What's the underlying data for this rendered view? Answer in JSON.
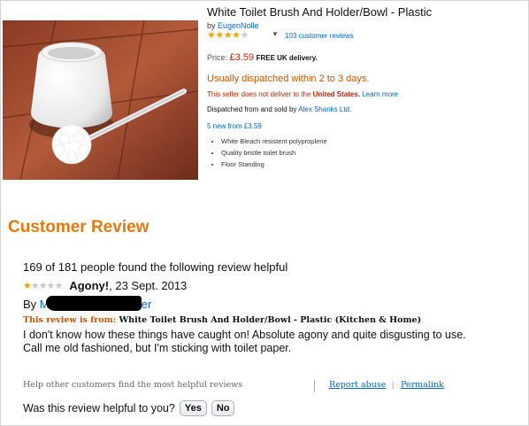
{
  "product": {
    "title": "White Toilet Brush And Holder/Bowl - Plastic",
    "by_label": "by",
    "brand": "EugenNolle",
    "rating_stars": 4,
    "rating_max": 5,
    "review_count": "103 customer reviews",
    "price_label": "Price:",
    "price": "£3.59",
    "free_delivery": "FREE UK delivery.",
    "dispatch": "Usually dispatched within 2 to 3 days.",
    "no_deliver_prefix": "This seller does not deliver to the",
    "no_deliver_country": "United States.",
    "learn_more": "Learn more",
    "sold_prefix": "Dispatched from and sold by",
    "seller": "Alex Shanks Ltd.",
    "new_from": "5 new from £3.59",
    "features": [
      "White Bleach resistent polyproplene",
      "Quality bristle toilet brush",
      "Floor Standing"
    ]
  },
  "review_section": {
    "heading": "Customer Review",
    "helpful_count": "169 of 181 people found the following review helpful",
    "rating_stars": 1,
    "rating_max": 5,
    "title": "Agony!",
    "date": ", 23 Sept. 2013",
    "by_label": "By",
    "reviewer_visible_start": "M",
    "reviewer_visible_end": "er",
    "from_label": "This review is from:",
    "from_product": "White Toilet Brush And Holder/Bowl - Plastic (Kitchen & Home)",
    "text": "I don't know how these things have caught on! Absolute agony and quite disgusting to use. Call me old fashioned, but I'm sticking with toilet paper.",
    "help_others": "Help other customers find the most helpful reviews",
    "report_abuse": "Report abuse",
    "permalink": "Permalink",
    "separator": "|",
    "helpful_question": "Was this review helpful to you?",
    "yes": "Yes",
    "no": "No"
  },
  "colors": {
    "accent_orange": "#e47911",
    "link_blue": "#0066c0",
    "price_red": "#b12704",
    "star_gold": "#f0a30a"
  }
}
